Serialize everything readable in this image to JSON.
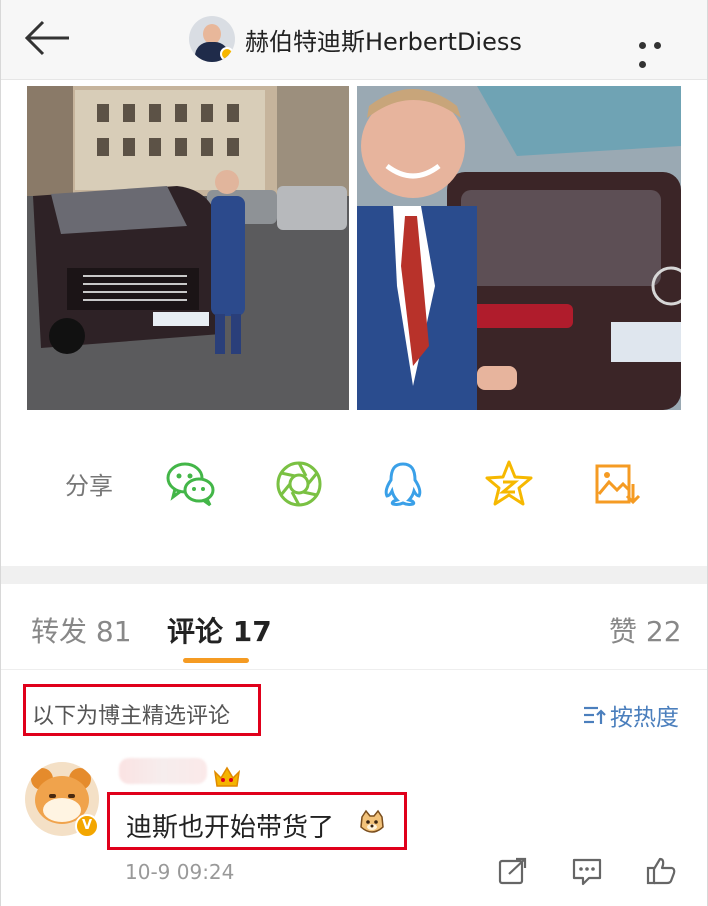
{
  "header": {
    "title": "赫伯特迪斯HerbertDiess",
    "back_icon": "back-arrow-icon",
    "more_icon": "more-dots-icon"
  },
  "photos": [
    {
      "name": "post-photo-1"
    },
    {
      "name": "post-photo-2"
    }
  ],
  "share": {
    "label": "分享",
    "icons": [
      "wechat-icon",
      "moments-icon",
      "qq-icon",
      "qzone-icon",
      "save-image-icon"
    ]
  },
  "tabs": {
    "repost": "转发 81",
    "comment": "评论 17",
    "like": "赞 22",
    "active": "comment"
  },
  "comments_header": {
    "filter_label": "以下为博主精选评论",
    "sort_label": "按热度"
  },
  "comment": {
    "text": "迪斯也开始带货了",
    "time": "10-9 09:24",
    "actions": [
      "share-icon",
      "reply-icon",
      "like-icon"
    ]
  },
  "colors": {
    "accent": "#f59b23",
    "highlight_box": "#e0001b",
    "link": "#4b7fbd",
    "wechat": "#43b648",
    "moments": "#7ac143",
    "qq": "#3aa0e8",
    "qzone": "#f6b800"
  }
}
